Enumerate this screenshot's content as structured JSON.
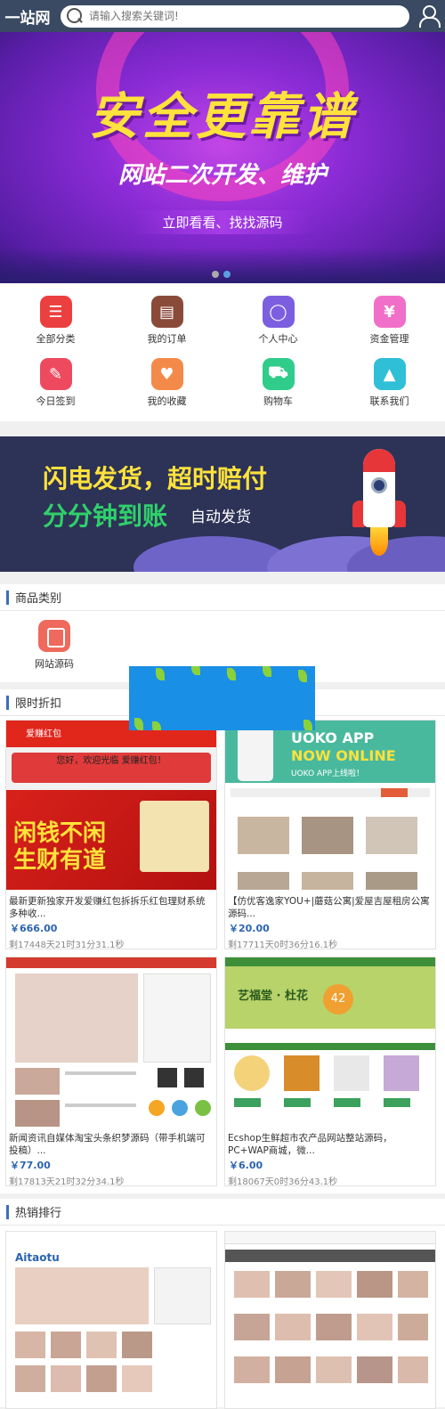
{
  "header": {
    "logo": "一站网",
    "search_placeholder": "请输入搜索关键词!"
  },
  "banner_main": {
    "headline": "安全更靠谱",
    "subline": "网站二次开发、维护",
    "cta": "立即看看、找找源码"
  },
  "menu": [
    {
      "label": "全部分类",
      "icon": "list-icon",
      "color": "#ec3f3f"
    },
    {
      "label": "我的订单",
      "icon": "clipboard-icon",
      "color": "#8a4a3a"
    },
    {
      "label": "个人中心",
      "icon": "user-icon",
      "color": "#7b5fe0"
    },
    {
      "label": "资金管理",
      "icon": "yen-icon",
      "color": "#f06fc8"
    },
    {
      "label": "今日签到",
      "icon": "pen-icon",
      "color": "#ee4a5f"
    },
    {
      "label": "我的收藏",
      "icon": "heart-icon",
      "color": "#f48a4a"
    },
    {
      "label": "购物车",
      "icon": "cart-icon",
      "color": "#2fcc8a"
    },
    {
      "label": "联系我们",
      "icon": "graduation-cap-icon",
      "color": "#2fbfd6"
    }
  ],
  "banner_promo": {
    "line1": "闪电发货，超时赔付",
    "line2": "分分钟到账",
    "line3": "自动发货"
  },
  "categories": {
    "title": "商品类别",
    "items": [
      {
        "label": "网站源码",
        "icon": "wallet-icon"
      }
    ]
  },
  "flash_sale": {
    "title": "限时折扣",
    "products": [
      {
        "name": "最新更新独家开发爱赚红包拆拆乐红包理财系统多种收...",
        "price": "￥666.00",
        "countdown": "剩17448天21时31分31.1秒"
      },
      {
        "name": "【仿优客逸家YOU+|蘑菇公寓|爱屋吉屋租房公寓源码...",
        "price": "￥20.00",
        "countdown": "剩17711天0时36分16.1秒"
      },
      {
        "name": "新闻资讯自媒体淘宝头条织梦源码（带手机端可投稿）...",
        "price": "￥77.00",
        "countdown": "剩17813天21时32分34.1秒"
      },
      {
        "name": "Ecshop生鲜超市农产品网站整站源码，PC+WAP商城，微...",
        "price": "￥6.00",
        "countdown": "剩18067天0时36分43.1秒"
      }
    ]
  },
  "hot_ranking": {
    "title": "热销排行"
  },
  "thumb_text": {
    "p1_top": "爱赚红包",
    "p1_greeting": "您好，欢迎光临 爱赚红包！",
    "p1_slogan": "闲钱不闲 生财有道",
    "p2_app": "UOKO APP",
    "p2_online": "NOW ONLINE",
    "p2_sub": "UOKO APP上线啦！",
    "p4_brand": "艺福堂 · 杜花",
    "p4_num": "42",
    "r1_logo": "Aitaotu"
  }
}
